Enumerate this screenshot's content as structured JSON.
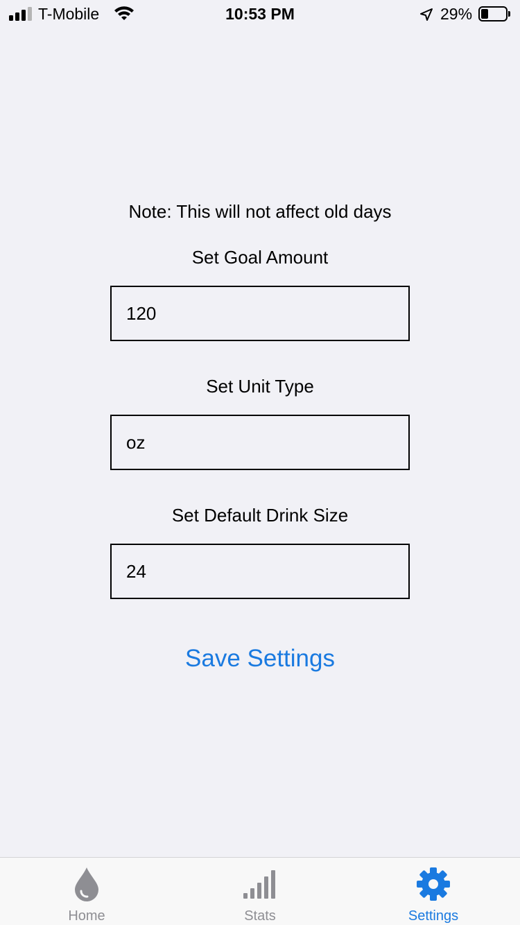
{
  "status_bar": {
    "carrier": "T-Mobile",
    "time": "10:53 PM",
    "battery_percent": "29%",
    "battery_level": 0.29
  },
  "settings": {
    "note": "Note: This will not affect old days",
    "goal_label": "Set Goal Amount",
    "goal_value": "120",
    "unit_label": "Set Unit Type",
    "unit_value": "oz",
    "drink_label": "Set Default Drink Size",
    "drink_value": "24",
    "save_label": "Save Settings"
  },
  "tab_bar": {
    "tabs": [
      {
        "label": "Home",
        "icon": "water-drop-icon",
        "active": false
      },
      {
        "label": "Stats",
        "icon": "bar-chart-icon",
        "active": false
      },
      {
        "label": "Settings",
        "icon": "gear-icon",
        "active": true
      }
    ]
  },
  "colors": {
    "accent": "#1a7ae0",
    "inactive": "#8e8e93",
    "background": "#f1f1f6"
  }
}
